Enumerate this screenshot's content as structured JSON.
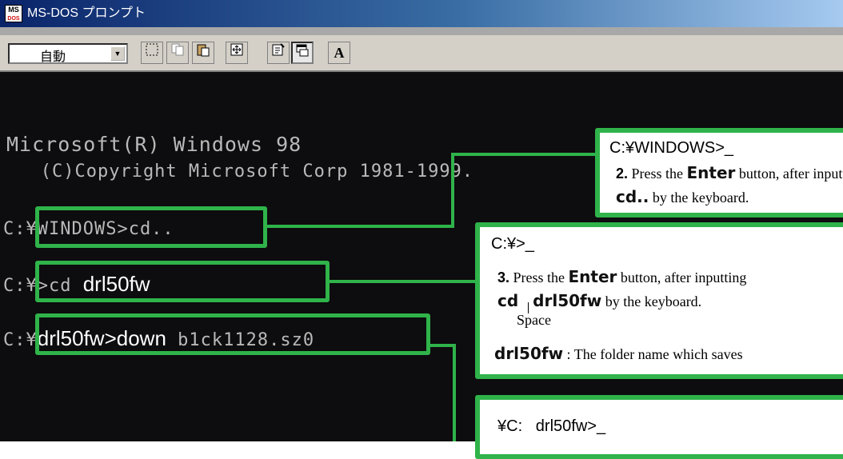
{
  "window": {
    "title": "MS-DOS プロンプト",
    "icon_text_top": "MS",
    "icon_text_bottom": "DOS"
  },
  "toolbar": {
    "font_size_value": "自動",
    "dropdown_glyph": "▼",
    "buttons": [
      {
        "name": "mark-button",
        "glyph": "⬚"
      },
      {
        "name": "copy-button",
        "glyph": "⎘"
      },
      {
        "name": "paste-button",
        "glyph": "📋"
      },
      {
        "name": "fullscreen-button",
        "glyph": "⛶"
      },
      {
        "name": "properties-button",
        "glyph": "☑"
      },
      {
        "name": "background-button",
        "glyph": "⧉"
      },
      {
        "name": "font-button",
        "glyph": "A"
      }
    ]
  },
  "console": {
    "line1": "Microsoft(R) Windows 98",
    "line2": "   (C)Copyright Microsoft Corp 1981-1999.",
    "prompt1": "C:¥WINDOWS>cd..",
    "prompt2_prefix": "C:¥>cd ",
    "prompt2_cmd": "drl50fw",
    "prompt3_prefix": "C:¥",
    "prompt3_cmd": "drl50fw>down",
    "prompt3_arg": " b1ck1128.sz0"
  },
  "callouts": {
    "c1": {
      "prompt": "C:¥WINDOWS>_",
      "step": "2.",
      "text_a": " Press the ",
      "key": "Enter",
      "text_b": " button, after inputting",
      "cmd": "cd..",
      "text_c": " by the keyboard."
    },
    "c2": {
      "prompt": "C:¥>_",
      "step": "3.",
      "text_a": " Press the ",
      "key": "Enter",
      "text_b": " button, after inputting",
      "cmd_a": "cd",
      "cmd_b": "drl50fw",
      "text_c": " by the keyboard.",
      "space_label": "Space",
      "folder": "drl50fw",
      "folder_desc": " : The folder name which saves"
    },
    "c3": {
      "prompt": "¥C:   drl50fw>_"
    }
  },
  "colors": {
    "highlight": "#2fb34a",
    "console_bg": "#0d0c0e",
    "console_text": "#b9b9b9",
    "titlebar": "#0a246a"
  }
}
